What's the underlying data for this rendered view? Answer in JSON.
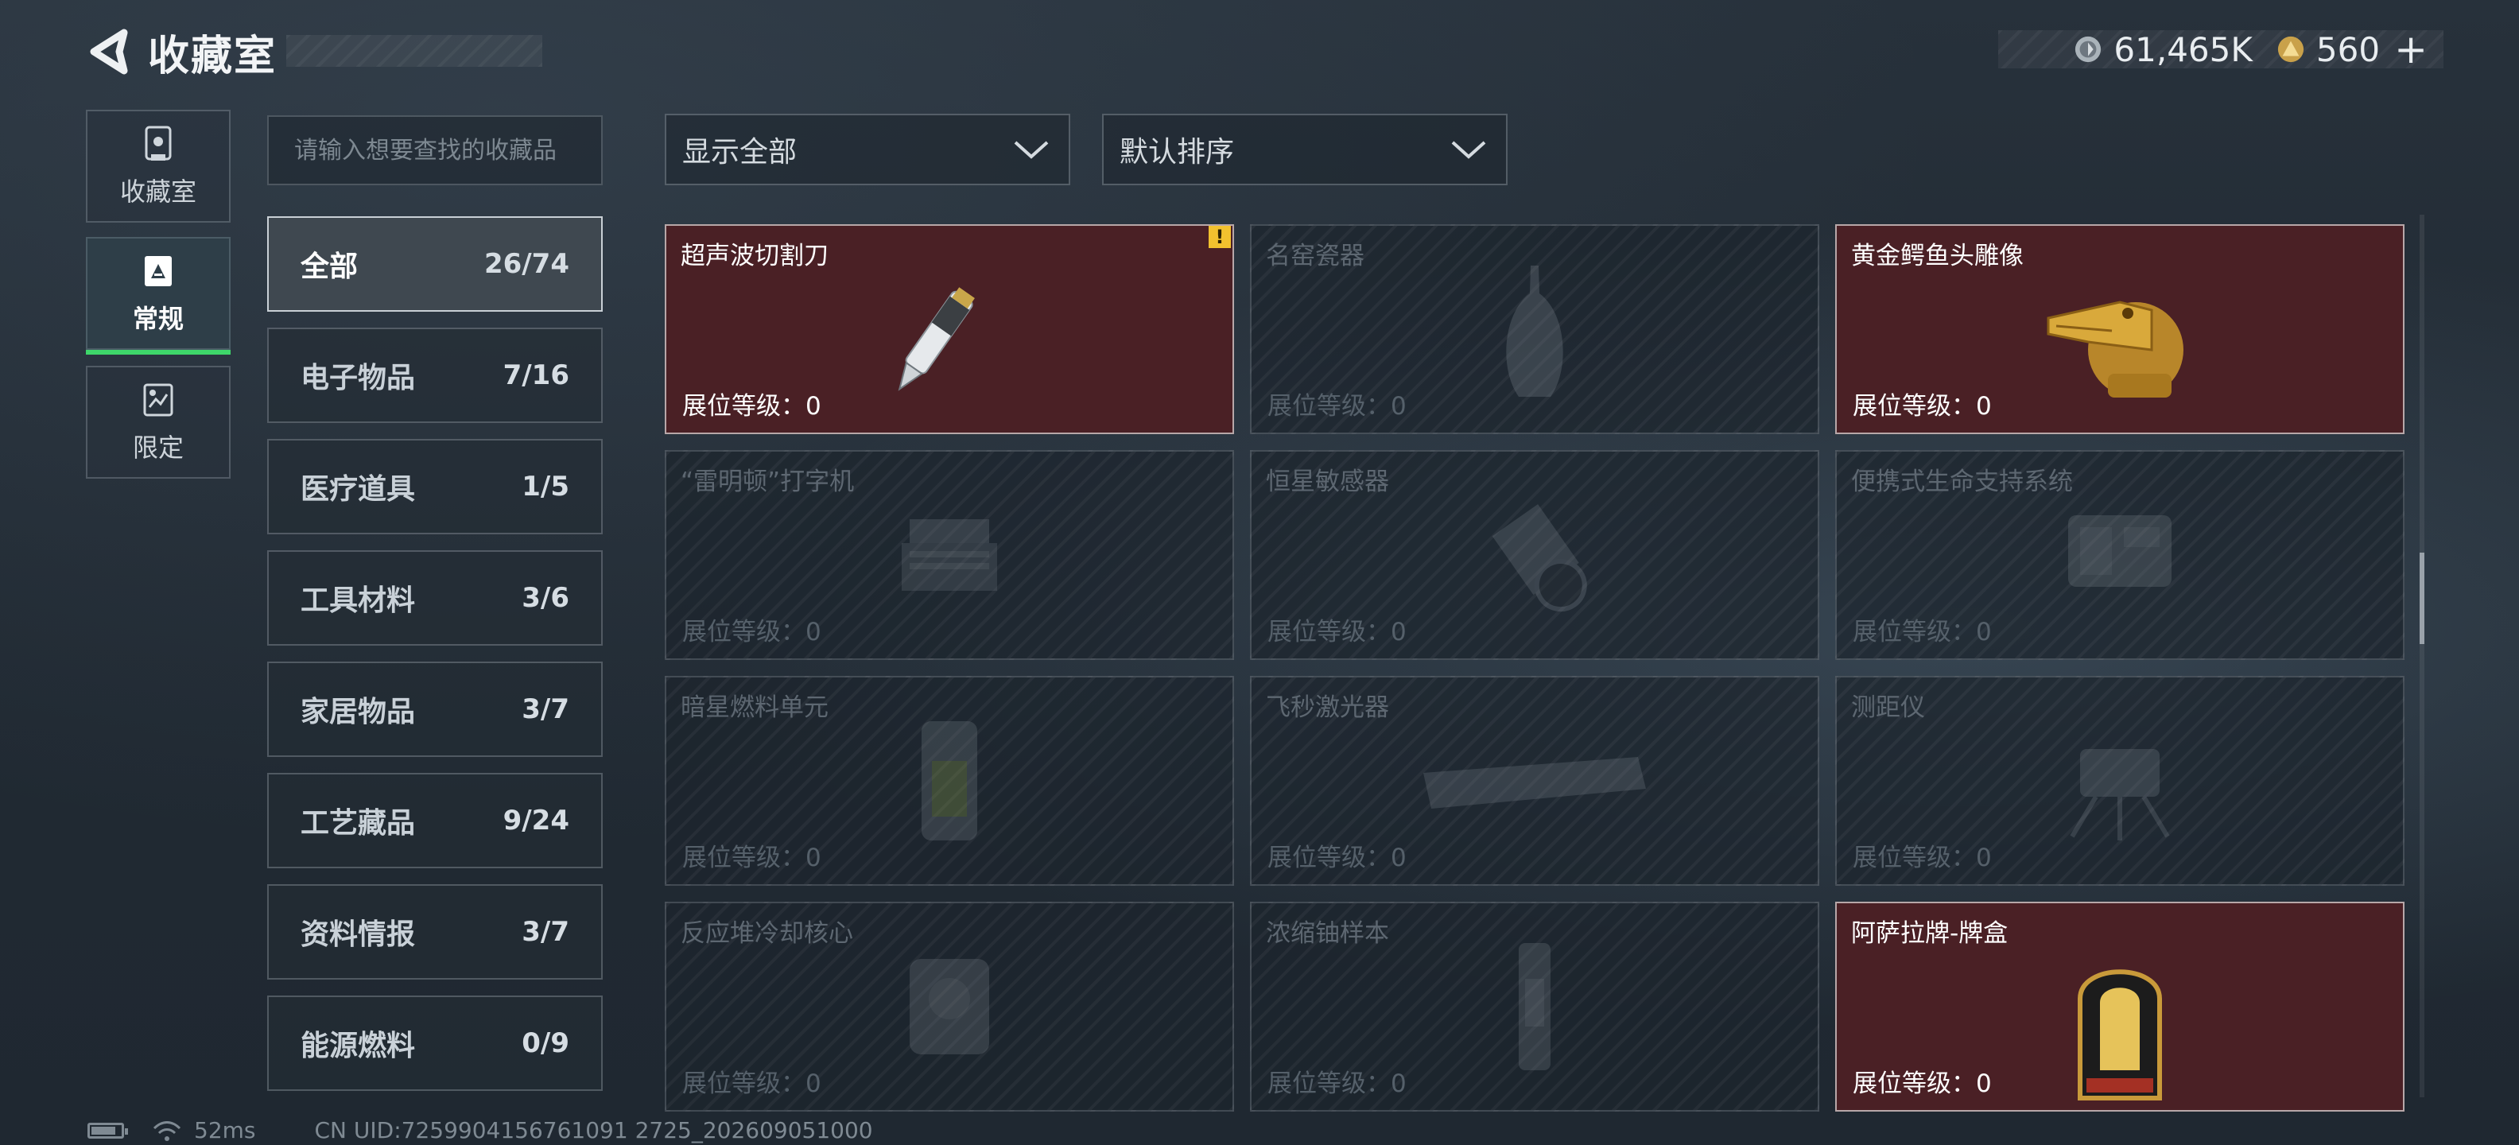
{
  "header": {
    "title": "收藏室",
    "currency": [
      {
        "icon": "silver-coin-icon",
        "value": "61,465K"
      },
      {
        "icon": "gold-triangle-coin-icon",
        "value": "560"
      }
    ],
    "add_label": "+"
  },
  "left_nav": [
    {
      "label": "收藏室",
      "icon": "collection-room-icon"
    },
    {
      "label": "常规",
      "icon": "regular-gallery-icon",
      "active": true
    },
    {
      "label": "限定",
      "icon": "limited-gallery-icon"
    }
  ],
  "search": {
    "placeholder": "请输入想要查找的收藏品"
  },
  "categories": [
    {
      "name": "全部",
      "count": "26/74",
      "active": true
    },
    {
      "name": "电子物品",
      "count": "7/16"
    },
    {
      "name": "医疗道具",
      "count": "1/5"
    },
    {
      "name": "工具材料",
      "count": "3/6"
    },
    {
      "name": "家居物品",
      "count": "3/7"
    },
    {
      "name": "工艺藏品",
      "count": "9/24"
    },
    {
      "name": "资料情报",
      "count": "3/7"
    },
    {
      "name": "能源燃料",
      "count": "0/9"
    }
  ],
  "filters": {
    "show": "显示全部",
    "sort": "默认排序"
  },
  "items": [
    {
      "name": "超声波切割刀",
      "level": "展位等级：0",
      "owned": true,
      "icon": "ultrasonic-knife-icon",
      "new": true
    },
    {
      "name": "名窑瓷器",
      "level": "展位等级：0",
      "owned": false,
      "icon": "porcelain-vase-icon"
    },
    {
      "name": "黄金鳄鱼头雕像",
      "level": "展位等级：0",
      "owned": true,
      "icon": "gold-crocodile-statue-icon"
    },
    {
      "name": "“雷明顿”打字机",
      "level": "展位等级：0",
      "owned": false,
      "icon": "typewriter-icon"
    },
    {
      "name": "恒星敏感器",
      "level": "展位等级：0",
      "owned": false,
      "icon": "star-sensor-icon"
    },
    {
      "name": "便携式生命支持系统",
      "level": "展位等级：0",
      "owned": false,
      "icon": "life-support-icon"
    },
    {
      "name": "暗星燃料单元",
      "level": "展位等级：0",
      "owned": false,
      "icon": "fuel-cell-icon"
    },
    {
      "name": "飞秒激光器",
      "level": "展位等级：0",
      "owned": false,
      "icon": "femtosecond-laser-icon"
    },
    {
      "name": "测距仪",
      "level": "展位等级：0",
      "owned": false,
      "icon": "rangefinder-icon"
    },
    {
      "name": "反应堆冷却核心",
      "level": "展位等级：0",
      "owned": false,
      "icon": "reactor-core-icon"
    },
    {
      "name": "浓缩铀样本",
      "level": "展位等级：0",
      "owned": false,
      "icon": "uranium-sample-icon"
    },
    {
      "name": "阿萨拉牌-牌盒",
      "level": "展位等级：0",
      "owned": true,
      "icon": "card-box-icon"
    }
  ],
  "status_bar": {
    "ping": "52ms",
    "uid": "CN UID:7259904156761091 2725_202609051000"
  },
  "colors": {
    "owned_card": "#4a2025",
    "active_tab_underline": "#3ed66a",
    "badge": "#f2c12e"
  }
}
